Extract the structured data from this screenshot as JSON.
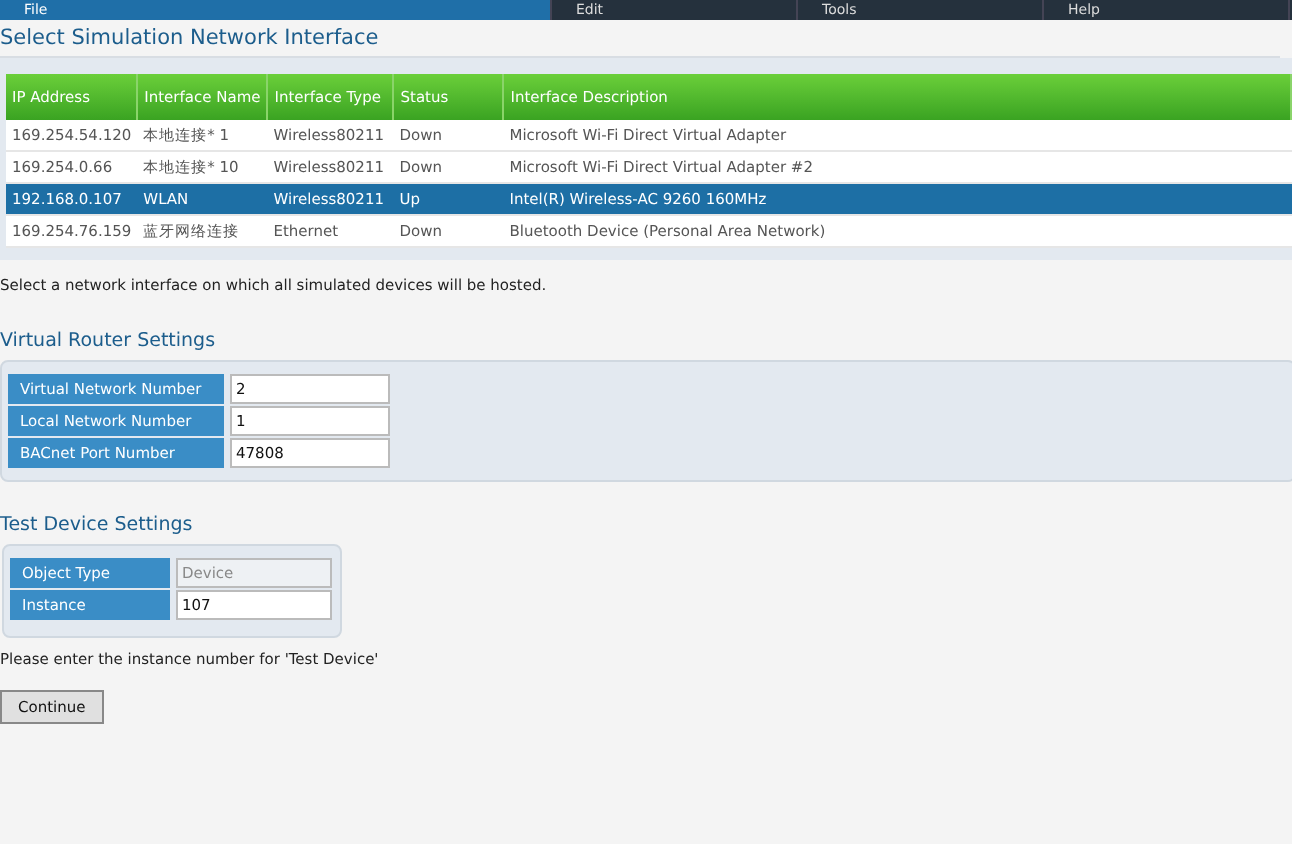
{
  "menu": [
    {
      "label": "File",
      "selected": true
    },
    {
      "label": "Edit",
      "selected": false
    },
    {
      "label": "Tools",
      "selected": false
    },
    {
      "label": "Help",
      "selected": false
    }
  ],
  "interface_section": {
    "title": "Select Simulation Network Interface",
    "table": {
      "columns": [
        "IP Address",
        "Interface Name",
        "Interface Type",
        "Status",
        "Interface Description"
      ],
      "rows": [
        {
          "cells": [
            "169.254.54.120",
            "本地连接* 1",
            "Wireless80211",
            "Down",
            "Microsoft Wi-Fi Direct Virtual Adapter"
          ],
          "selected": false
        },
        {
          "cells": [
            "169.254.0.66",
            "本地连接* 10",
            "Wireless80211",
            "Down",
            "Microsoft Wi-Fi Direct Virtual Adapter #2"
          ],
          "selected": false
        },
        {
          "cells": [
            "192.168.0.107",
            "WLAN",
            "Wireless80211",
            "Up",
            "Intel(R) Wireless-AC 9260 160MHz"
          ],
          "selected": true
        },
        {
          "cells": [
            "169.254.76.159",
            "蓝牙网络连接",
            "Ethernet",
            "Down",
            "Bluetooth Device (Personal Area Network)"
          ],
          "selected": false
        }
      ]
    },
    "hint": "Select a network interface on which all simulated devices will be hosted."
  },
  "router_section": {
    "title": "Virtual Router Settings",
    "fields": [
      {
        "label": "Virtual Network Number",
        "value": "2",
        "disabled": false
      },
      {
        "label": "Local Network Number",
        "value": "1",
        "disabled": false
      },
      {
        "label": "BACnet Port Number",
        "value": "47808",
        "disabled": false
      }
    ]
  },
  "device_section": {
    "title": "Test Device Settings",
    "fields": [
      {
        "label": "Object Type",
        "value": "Device",
        "disabled": true
      },
      {
        "label": "Instance",
        "value": "107",
        "disabled": false
      }
    ],
    "hint": "Please enter the instance number for 'Test Device'"
  },
  "buttons": [
    "Continue"
  ]
}
